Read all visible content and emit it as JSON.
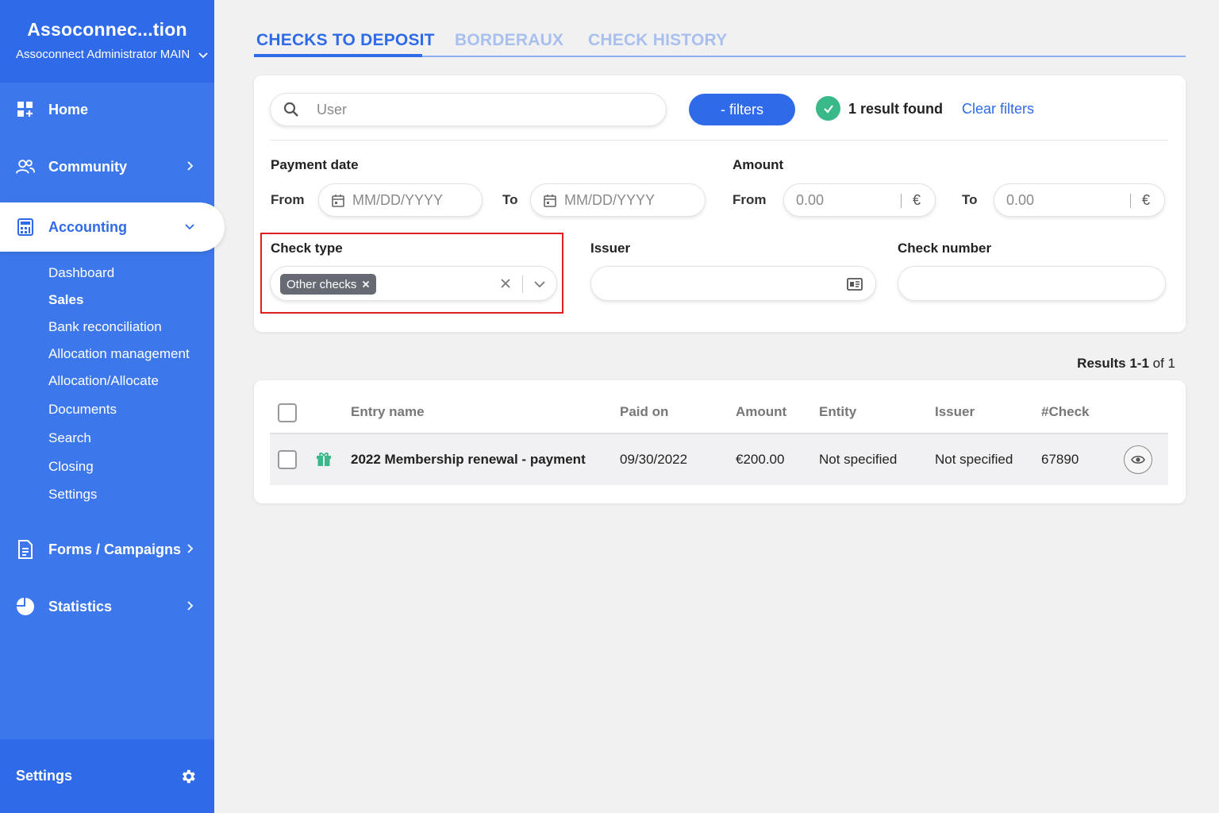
{
  "sidebar": {
    "org_name": "Assoconnec...tion",
    "account_label": "Assoconnect Administrator MAIN",
    "nav": {
      "home": "Home",
      "community": "Community",
      "accounting": "Accounting",
      "forms": "Forms / Campaigns",
      "statistics": "Statistics"
    },
    "accounting_sub": [
      "Dashboard",
      "Sales",
      "Bank reconciliation",
      "Allocation management",
      "Allocation/Allocate",
      "Documents",
      "Search",
      "Closing",
      "Settings"
    ],
    "active_sub": "Sales",
    "footer_label": "Settings"
  },
  "tabs": [
    "CHECKS TO DEPOSIT",
    "BORDERAUX",
    "CHECK HISTORY"
  ],
  "active_tab": "CHECKS TO DEPOSIT",
  "filters": {
    "search_placeholder": "User",
    "filters_button": "- filters",
    "result_found": "1 result found",
    "clear_filters": "Clear filters",
    "payment_date_label": "Payment date",
    "amount_label": "Amount",
    "from_label": "From",
    "to_label": "To",
    "date_placeholder": "MM/DD/YYYY",
    "amount_placeholder": "0.00",
    "currency": "€",
    "check_type_label": "Check type",
    "check_type_value": "Other checks",
    "issuer_label": "Issuer",
    "check_number_label": "Check number"
  },
  "results": {
    "prefix": "Results",
    "range": "1-1",
    "of": "of 1"
  },
  "table": {
    "columns": [
      "Entry name",
      "Paid on",
      "Amount",
      "Entity",
      "Issuer",
      "#Check"
    ],
    "rows": [
      {
        "entry_name": "2022 Membership renewal - payment",
        "paid_on": "09/30/2022",
        "amount": "€200.00",
        "entity": "Not specified",
        "issuer": "Not specified",
        "check": "67890"
      }
    ]
  },
  "colors": {
    "brand_blue": "#2f6ae8",
    "sidebar_blue": "#3c78ec",
    "success_green": "#39b889",
    "highlight_red": "#e02020"
  }
}
